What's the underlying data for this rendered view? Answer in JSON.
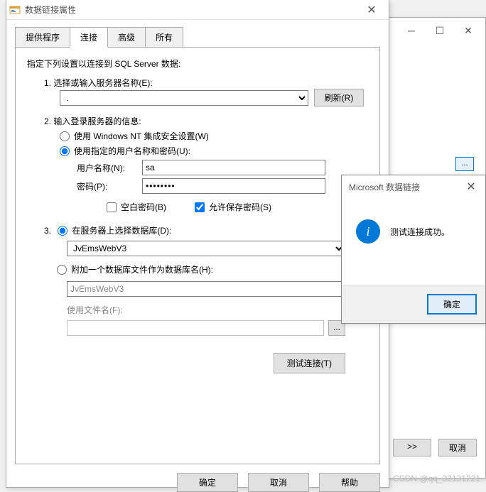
{
  "main": {
    "title": "数据链接属性",
    "tabs": [
      "提供程序",
      "连接",
      "高级",
      "所有"
    ],
    "active_tab": 1,
    "instr": "指定下列设置以连接到 SQL Server 数据:",
    "step1_label": "1. 选择或输入服务器名称(E):",
    "server_value": ".",
    "refresh_btn": "刷新(R)",
    "step2_label": "2. 输入登录服务器的信息:",
    "auth_nt": "使用 Windows NT 集成安全设置(W)",
    "auth_user": "使用指定的用户名称和密码(U):",
    "username_label": "用户名称(N):",
    "username_value": "sa",
    "password_label": "密码(P):",
    "password_value": "••••••••",
    "blank_pw": "空白密码(B)",
    "save_pw": "允许保存密码(S)",
    "step3_db": "在服务器上选择数据库(D):",
    "db_value": "JvEmsWebV3",
    "step3_attach": "附加一个数据库文件作为数据库名(H):",
    "attach_value": "JvEmsWebV3",
    "file_label": "使用文件名(F):",
    "test_btn": "测试连接(T)",
    "ok_btn": "确定",
    "cancel_btn": "取消",
    "help_btn": "帮助"
  },
  "bg": {
    "next_btn": ">>",
    "cancel_btn": "取消"
  },
  "msgbox": {
    "title": "Microsoft 数据链接",
    "message": "测试连接成功。",
    "ok_btn": "确定"
  },
  "watermark": "CSDN @qq_32131221"
}
